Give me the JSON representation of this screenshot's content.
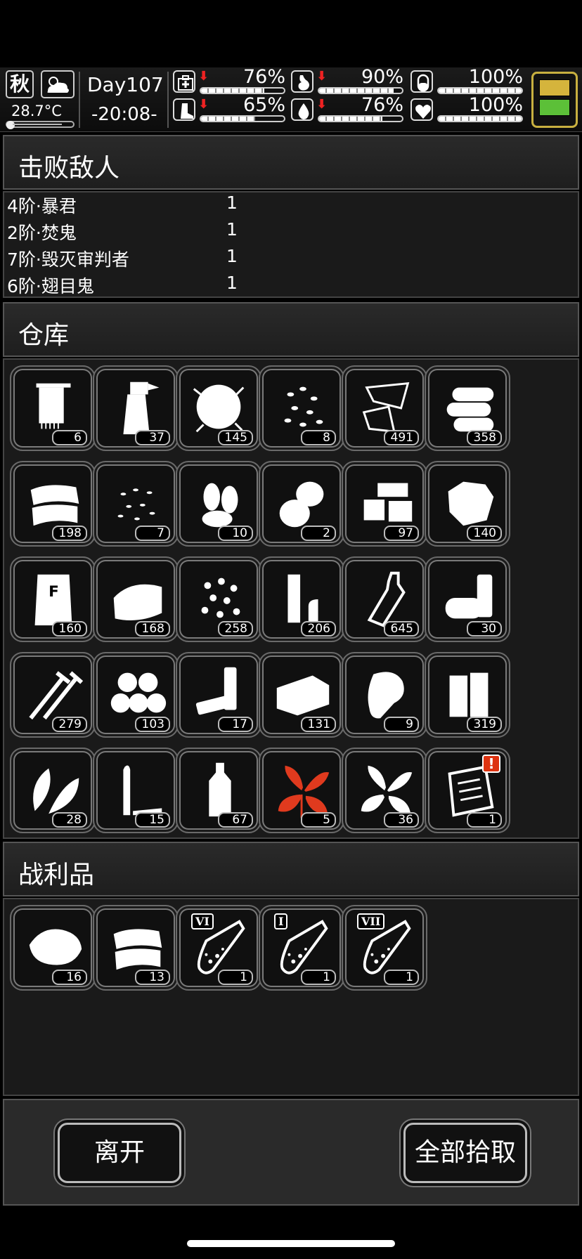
{
  "hud": {
    "season": "秋",
    "temperature": "28.7°C",
    "day": "Day107",
    "time": "-20:08-",
    "stats": [
      {
        "name": "health",
        "icon": "medkit-icon",
        "value": "76%",
        "level": 0.76,
        "decreasing": true
      },
      {
        "name": "hunger",
        "icon": "stomach-icon",
        "value": "90%",
        "level": 0.9,
        "decreasing": true
      },
      {
        "name": "sanity",
        "icon": "pill-icon",
        "value": "100%",
        "level": 1.0,
        "decreasing": false
      },
      {
        "name": "stamina",
        "icon": "boot-icon",
        "value": "65%",
        "level": 0.65,
        "decreasing": true
      },
      {
        "name": "thirst",
        "icon": "water-drop-icon",
        "value": "76%",
        "level": 0.76,
        "decreasing": true
      },
      {
        "name": "mood",
        "icon": "heart-icon",
        "value": "100%",
        "level": 1.0,
        "decreasing": false
      }
    ],
    "battery_colors": [
      "#d5b43c",
      "#5cc038"
    ]
  },
  "defeated": {
    "title": "击败敌人",
    "enemies": [
      {
        "name": "4阶·暴君",
        "count": "1"
      },
      {
        "name": "2阶·焚鬼",
        "count": "1"
      },
      {
        "name": "7阶·毁灭审判者",
        "count": "1"
      },
      {
        "name": "6阶·翅目鬼",
        "count": "1"
      }
    ]
  },
  "warehouse": {
    "title": "仓库",
    "items": [
      {
        "icon": "towel-icon",
        "qty": "6"
      },
      {
        "icon": "spray-bottle-icon",
        "qty": "37"
      },
      {
        "icon": "cotton-fluff-icon",
        "qty": "145"
      },
      {
        "icon": "beans-icon",
        "qty": "8"
      },
      {
        "icon": "glass-shards-icon",
        "qty": "491"
      },
      {
        "icon": "logs-icon",
        "qty": "358"
      },
      {
        "icon": "folded-cloth-icon",
        "qty": "198"
      },
      {
        "icon": "seeds-icon",
        "qty": "7"
      },
      {
        "icon": "almonds-icon",
        "qty": "10"
      },
      {
        "icon": "potatoes-icon",
        "qty": "2"
      },
      {
        "icon": "wood-blocks-icon",
        "qty": "97"
      },
      {
        "icon": "ore-chunk-icon",
        "qty": "140"
      },
      {
        "icon": "flour-bag-icon",
        "qty": "160"
      },
      {
        "icon": "leather-icon",
        "qty": "168"
      },
      {
        "icon": "pellets-icon",
        "qty": "258"
      },
      {
        "icon": "pipes-icon",
        "qty": "206"
      },
      {
        "icon": "glass-bottle-icon",
        "qty": "645"
      },
      {
        "icon": "canisters-icon",
        "qty": "30"
      },
      {
        "icon": "screws-icon",
        "qty": "279"
      },
      {
        "icon": "cotton-bolls-icon",
        "qty": "103"
      },
      {
        "icon": "batteries-icon",
        "qty": "17"
      },
      {
        "icon": "fabric-icon",
        "qty": "131"
      },
      {
        "icon": "meat-icon",
        "qty": "9"
      },
      {
        "icon": "battery-cells-icon",
        "qty": "319"
      },
      {
        "icon": "leaves-icon",
        "qty": "28"
      },
      {
        "icon": "bullets-icon",
        "qty": "15"
      },
      {
        "icon": "oil-bottle-icon",
        "qty": "67"
      },
      {
        "icon": "red-herb-icon",
        "qty": "5",
        "color": "#e03a1e"
      },
      {
        "icon": "herb-icon",
        "qty": "36"
      },
      {
        "icon": "clipboard-icon",
        "qty": "1",
        "alert": "!"
      }
    ]
  },
  "loot": {
    "title": "战利品",
    "items": [
      {
        "icon": "sweet-potato-icon",
        "qty": "16"
      },
      {
        "icon": "folded-cloth-icon",
        "qty": "13"
      },
      {
        "icon": "test-tube-icon",
        "qty": "1",
        "label": "VI"
      },
      {
        "icon": "test-tube-icon",
        "qty": "1",
        "label": "I"
      },
      {
        "icon": "test-tube-icon",
        "qty": "1",
        "label": "VII"
      }
    ]
  },
  "actions": {
    "leave": "离开",
    "take_all": "全部拾取"
  }
}
